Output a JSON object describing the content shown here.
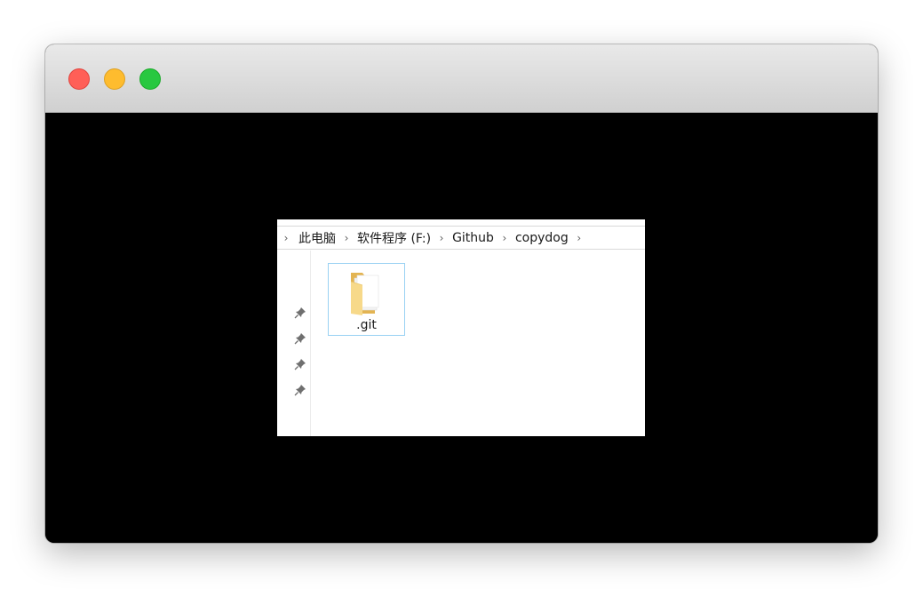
{
  "breadcrumb": {
    "items": [
      {
        "label": "此电脑"
      },
      {
        "label": "软件程序 (F:)"
      },
      {
        "label": "Github"
      },
      {
        "label": "copydog"
      }
    ],
    "separator": "›"
  },
  "files": [
    {
      "name": ".git",
      "icon": "folder-icon",
      "selected": true
    }
  ],
  "navpane": {
    "pinned_icons": [
      "pin-icon",
      "pin-icon",
      "pin-icon",
      "pin-icon"
    ]
  },
  "colors": {
    "selection_border": "#99d1f3",
    "folder_yellow": "#f4d27c",
    "close": "#ff5f57",
    "minimize": "#febc2e",
    "zoom": "#28c840"
  }
}
